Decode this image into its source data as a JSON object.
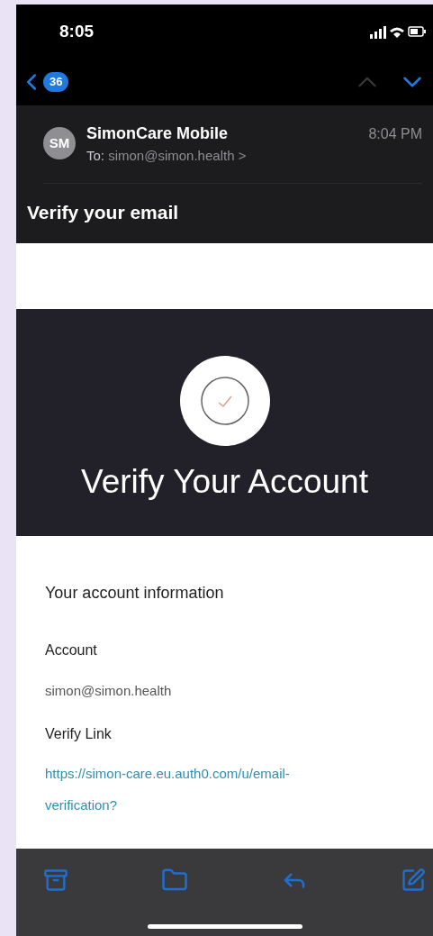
{
  "status_bar": {
    "time": "8:05"
  },
  "nav": {
    "unread_count": "36"
  },
  "message": {
    "avatar": "SM",
    "sender": "SimonCare Mobile",
    "to_label": "To:",
    "to": "simon@simon.health >",
    "time": "8:04 PM",
    "subject": "Verify your email"
  },
  "body": {
    "title": "Verify Your Account",
    "section": "Your account information",
    "fields": [
      {
        "label": "Account",
        "value": "simon@simon.health",
        "kind": "text"
      },
      {
        "label": "Verify Link",
        "value": "https://simon-care.eu.auth0.com/u/email-verification?",
        "kind": "link"
      }
    ]
  }
}
